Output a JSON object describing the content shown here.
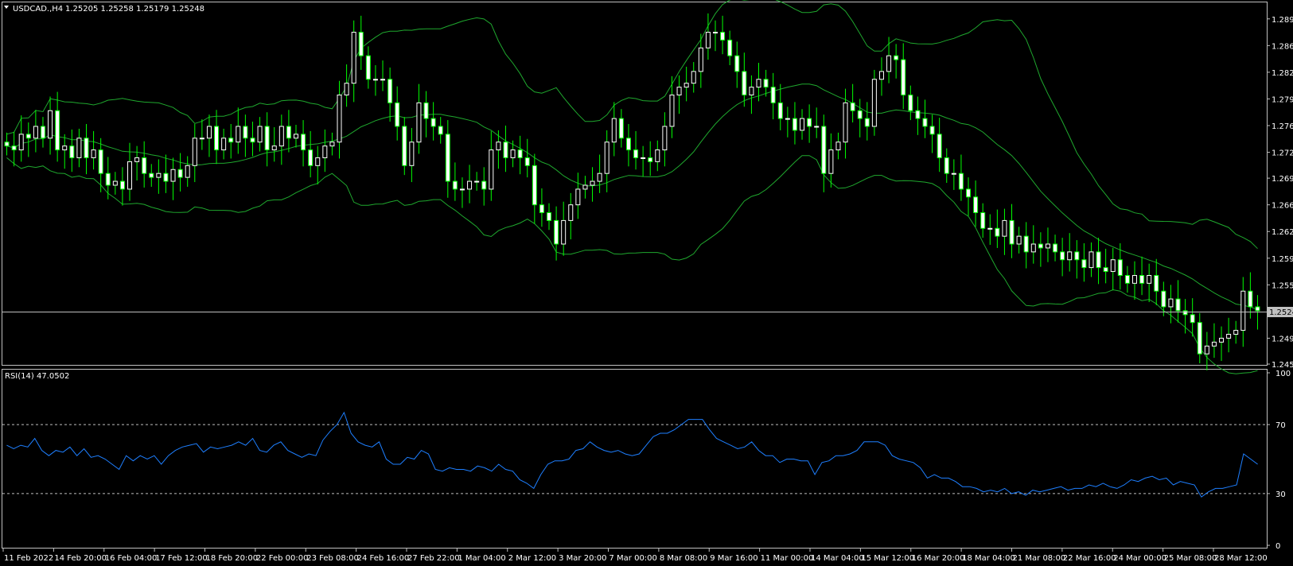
{
  "header": {
    "menu_arrow": "triangle-down",
    "symbol": "USDCAD.,H4",
    "ohlc": "1.25205 1.25258 1.25179 1.25248"
  },
  "rsi_header": "RSI(14) 47.0502",
  "current_price": "1.25248",
  "colors": {
    "background": "#000000",
    "frame": "#c0c0c0",
    "bull_candle": "#ffffff",
    "bear_candle": "#ffffff",
    "wick": "#00ff00",
    "bollinger": "#1fa82e",
    "rsi_line": "#1e7fff",
    "level_line": "#c0c0c0"
  },
  "chart_data": [
    {
      "type": "candlestick",
      "series": [
        {
          "name": "USDCAD.",
          "values": [
            1.2735,
            1.273,
            1.275,
            1.2745,
            1.276,
            1.2745,
            1.278,
            1.273,
            1.2735,
            1.272,
            1.2745,
            1.272,
            1.273,
            1.27,
            1.2685,
            1.269,
            1.268,
            1.2715,
            1.272,
            1.27,
            1.2695,
            1.27,
            1.269,
            1.2705,
            1.2695,
            1.271,
            1.2745,
            1.2745,
            1.276,
            1.273,
            1.2745,
            1.274,
            1.276,
            1.2745,
            1.274,
            1.276,
            1.273,
            1.2735,
            1.276,
            1.2745,
            1.275,
            1.273,
            1.271,
            1.272,
            1.2735,
            1.274,
            1.28,
            1.2815,
            1.288,
            1.285,
            1.282,
            1.282,
            1.282,
            1.279,
            1.276,
            1.271,
            1.274,
            1.279,
            1.277,
            1.276,
            1.275,
            1.269,
            1.268,
            1.268,
            1.269,
            1.269,
            1.268,
            1.273,
            1.274,
            1.272,
            1.273,
            1.272,
            1.271,
            1.266,
            1.265,
            1.264,
            1.261,
            1.264,
            1.266,
            1.268,
            1.2685,
            1.269,
            1.27,
            1.274,
            1.277,
            1.2745,
            1.273,
            1.272,
            1.272,
            1.2715,
            1.273,
            1.276,
            1.28,
            1.281,
            1.2815,
            1.283,
            1.286,
            1.288,
            1.288,
            1.287,
            1.285,
            1.283,
            1.28,
            1.281,
            1.282,
            1.281,
            1.279,
            1.277,
            1.277,
            1.2755,
            1.277,
            1.276,
            1.276,
            1.27,
            1.273,
            1.274,
            1.279,
            1.278,
            1.277,
            1.276,
            1.282,
            1.283,
            1.285,
            1.2845,
            1.28,
            1.278,
            1.277,
            1.276,
            1.275,
            1.272,
            1.27,
            1.27,
            1.268,
            1.267,
            1.265,
            1.263,
            1.263,
            1.262,
            1.264,
            1.261,
            1.262,
            1.26,
            1.261,
            1.2605,
            1.261,
            1.26,
            1.259,
            1.26,
            1.259,
            1.258,
            1.26,
            1.258,
            1.2575,
            1.259,
            1.257,
            1.256,
            1.257,
            1.256,
            1.257,
            1.255,
            1.253,
            1.254,
            1.2525,
            1.252,
            1.251,
            1.247,
            1.248,
            1.2485,
            1.249,
            1.2495,
            1.25,
            1.255,
            1.253,
            1.2525
          ]
        }
      ],
      "y_ticks": [
        "1.28970",
        "1.28630",
        "1.28290",
        "1.27950",
        "1.27610",
        "1.27270",
        "1.26940",
        "1.26600",
        "1.26260",
        "1.25920",
        "1.25580",
        "1.24900",
        "1.24570"
      ],
      "ylim": [
        1.2457,
        1.2915
      ],
      "x_ticks": [
        "11 Feb 2022",
        "14 Feb 20:00",
        "16 Feb 04:00",
        "17 Feb 12:00",
        "18 Feb 20:00",
        "22 Feb 00:00",
        "23 Feb 08:00",
        "24 Feb 16:00",
        "27 Feb 22:00",
        "1 Mar 04:00",
        "2 Mar 12:00",
        "3 Mar 20:00",
        "7 Mar 00:00",
        "8 Mar 08:00",
        "9 Mar 16:00",
        "11 Mar 00:00",
        "14 Mar 04:00",
        "15 Mar 12:00",
        "16 Mar 20:00",
        "18 Mar 04:00",
        "21 Mar 08:00",
        "22 Mar 16:00",
        "24 Mar 00:00",
        "25 Mar 08:00",
        "28 Mar 12:00"
      ],
      "indicators": [
        "Bollinger Bands"
      ]
    },
    {
      "type": "line",
      "series": [
        {
          "name": "RSI(14)",
          "values": [
            58,
            56,
            58,
            57,
            62,
            55,
            52,
            55,
            54,
            57,
            52,
            56,
            51,
            52,
            50,
            47,
            44,
            52,
            49,
            52,
            50,
            52,
            47,
            52,
            55,
            57,
            58,
            59,
            54,
            57,
            56,
            57,
            58,
            60,
            58,
            62,
            55,
            54,
            58,
            60,
            55,
            53,
            51,
            53,
            52,
            61,
            66,
            70,
            77,
            65,
            60,
            58,
            57,
            60,
            50,
            47,
            47,
            51,
            50,
            55,
            53,
            44,
            43,
            45,
            44,
            44,
            43,
            46,
            45,
            43,
            47,
            44,
            43,
            38,
            36,
            33,
            41,
            47,
            49,
            49,
            50,
            55,
            56,
            60,
            57,
            55,
            54,
            55,
            53,
            52,
            53,
            58,
            63,
            65,
            65,
            67,
            70,
            73,
            73,
            73,
            67,
            62,
            60,
            58,
            56,
            57,
            60,
            55,
            52,
            52,
            48,
            50,
            50,
            49,
            49,
            41,
            48,
            49,
            52,
            52,
            53,
            55,
            60,
            60,
            60,
            58,
            52,
            50,
            49,
            48,
            45,
            39,
            41,
            39,
            39,
            37,
            34,
            34,
            33,
            31,
            32,
            31,
            33,
            30,
            31,
            29,
            32,
            31,
            32,
            33,
            34,
            32,
            33,
            33,
            35,
            34,
            36,
            34,
            33,
            35,
            38,
            37,
            39,
            40,
            38,
            39,
            35,
            37,
            36,
            35,
            28,
            31,
            33,
            33,
            34,
            35,
            53,
            50,
            47
          ]
        }
      ],
      "y_ticks": [
        "100",
        "70",
        "30",
        "0"
      ],
      "ylim": [
        0,
        100
      ],
      "levels": [
        70,
        30
      ]
    }
  ]
}
